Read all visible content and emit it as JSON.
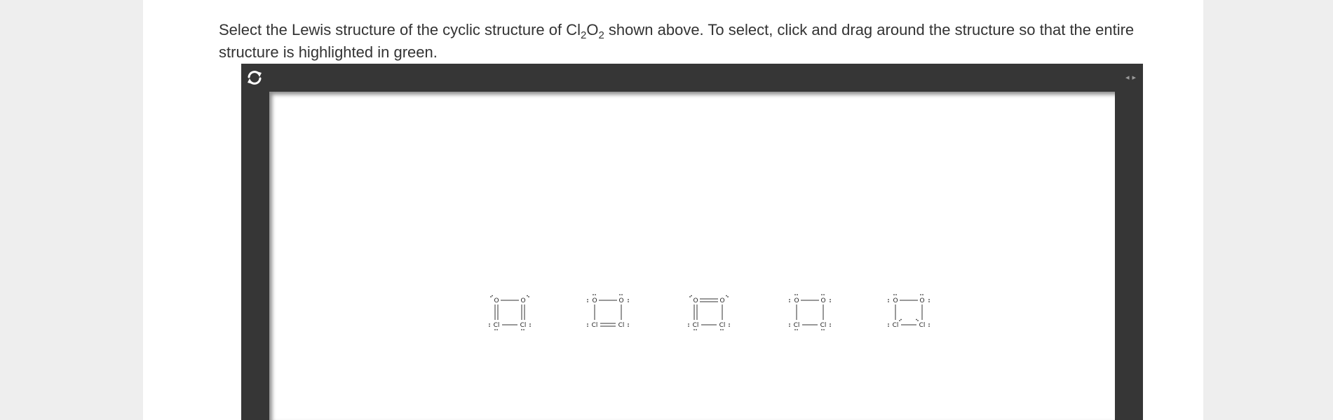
{
  "question": {
    "text_before": "Select the Lewis structure of the cyclic structure of Cl",
    "sub1": "2",
    "mid": "O",
    "sub2": "2",
    "text_after": " shown above. To select, click and drag around the structure so that the entire structure is highlighted in green."
  },
  "viewer": {
    "reset_icon": "refresh-icon",
    "nav_left": "◂",
    "nav_right": "▸",
    "background": "#363636"
  },
  "atoms": {
    "oxygen": "O",
    "chlorine": "Cl"
  },
  "structures": [
    {
      "id": "A",
      "top_bond": "single",
      "bottom_bond": "single",
      "left_side": "double",
      "right_side": "double"
    },
    {
      "id": "B",
      "top_bond": "single",
      "bottom_bond": "double",
      "left_side": "single",
      "right_side": "single"
    },
    {
      "id": "C",
      "top_bond": "double",
      "bottom_bond": "single",
      "left_side": "double",
      "right_side": "single"
    },
    {
      "id": "D",
      "top_bond": "single",
      "bottom_bond": "single",
      "left_side": "single",
      "right_side": "single"
    },
    {
      "id": "E",
      "top_bond": "single",
      "bottom_bond": "single",
      "left_side": "single",
      "right_side": "single"
    }
  ]
}
